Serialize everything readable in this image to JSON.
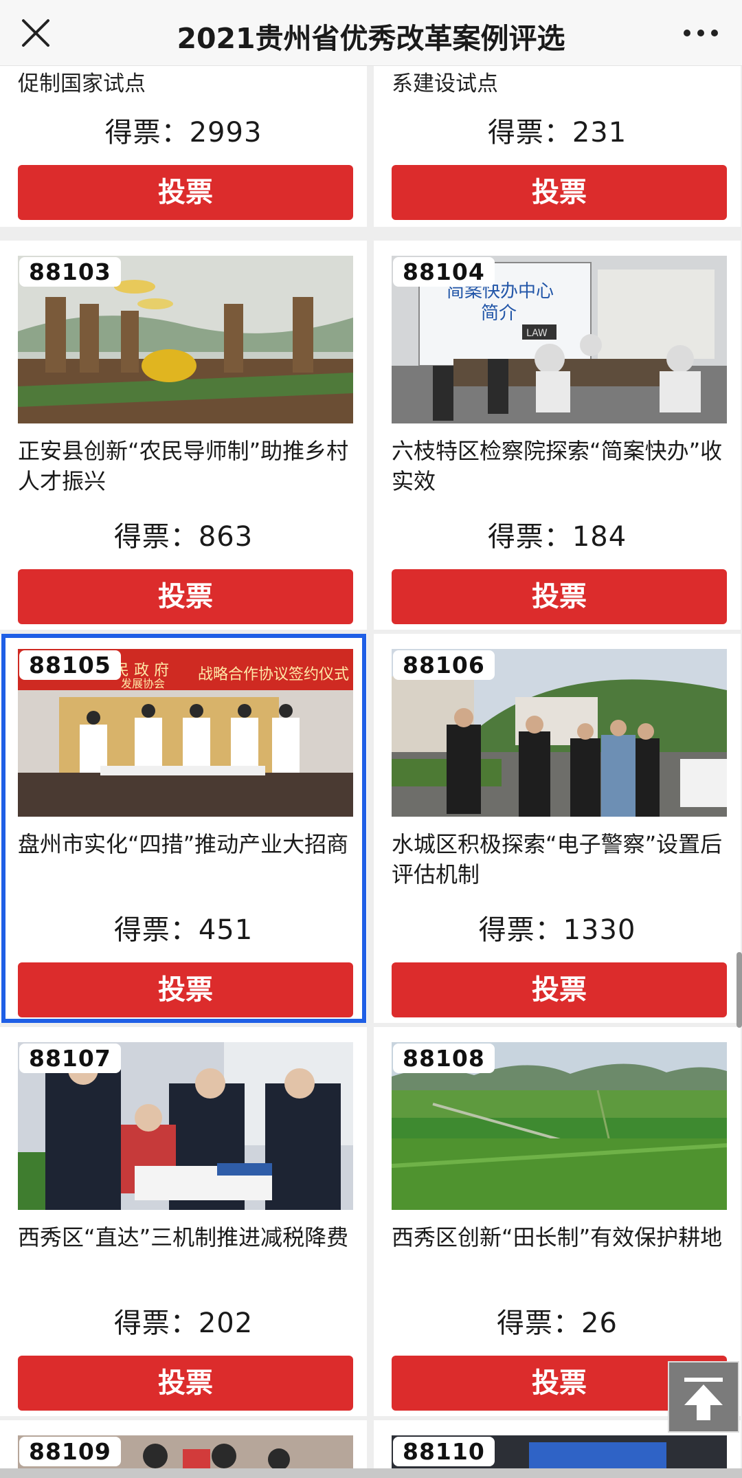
{
  "header": {
    "title": "2021贵州省优秀改革案例评选"
  },
  "vote_prefix": "得票：",
  "top_cards": [
    {
      "title_fragment": "促制国家试点",
      "votes": "2993",
      "button": "投票"
    },
    {
      "title_fragment": "系建设试点",
      "votes": "231",
      "button": "投票"
    }
  ],
  "cards": [
    {
      "id": "88103",
      "title": "正安县创新“农民导师制”助推乡村人才振兴",
      "votes": "863",
      "button": "投票",
      "photo": "farmers-field"
    },
    {
      "id": "88104",
      "title": "六枝特区检察院探索“简案快办”收实效",
      "votes": "184",
      "button": "投票",
      "photo": "meeting-room",
      "photo_text": {
        "line1": "简案快办中心",
        "line2": "简介",
        "sign": "LAW"
      }
    },
    {
      "id": "88105",
      "title": "盘州市实化“四措”推动产业大招商",
      "votes": "451",
      "button": "投票",
      "photo": "signing-ceremony",
      "photo_text": {
        "banner_left": "民 政 府",
        "banner_left2": "发展协会",
        "banner_right": "战略合作协议签约仪式"
      }
    },
    {
      "id": "88106",
      "title": "水城区积极探索“电子警察”设置后评估机制",
      "votes": "1330",
      "button": "投票",
      "photo": "outdoor-officials"
    },
    {
      "id": "88107",
      "title": "西秀区“直达”三机制推进减税降费",
      "votes": "202",
      "button": "投票",
      "photo": "tax-office"
    },
    {
      "id": "88108",
      "title": "西秀区创新“田长制”有效保护耕地",
      "votes": "26",
      "button": "投票",
      "photo": "green-fields"
    },
    {
      "id": "88109",
      "photo": "crowd"
    },
    {
      "id": "88110",
      "photo": "screen-room"
    }
  ],
  "colors": {
    "vote_button": "#dc2c2c",
    "highlight": "#1f5fe6",
    "page_bg": "#eeeeee"
  },
  "icons": {
    "close": "close-icon",
    "more": "more-icon",
    "scroll_top": "arrow-up-icon"
  }
}
